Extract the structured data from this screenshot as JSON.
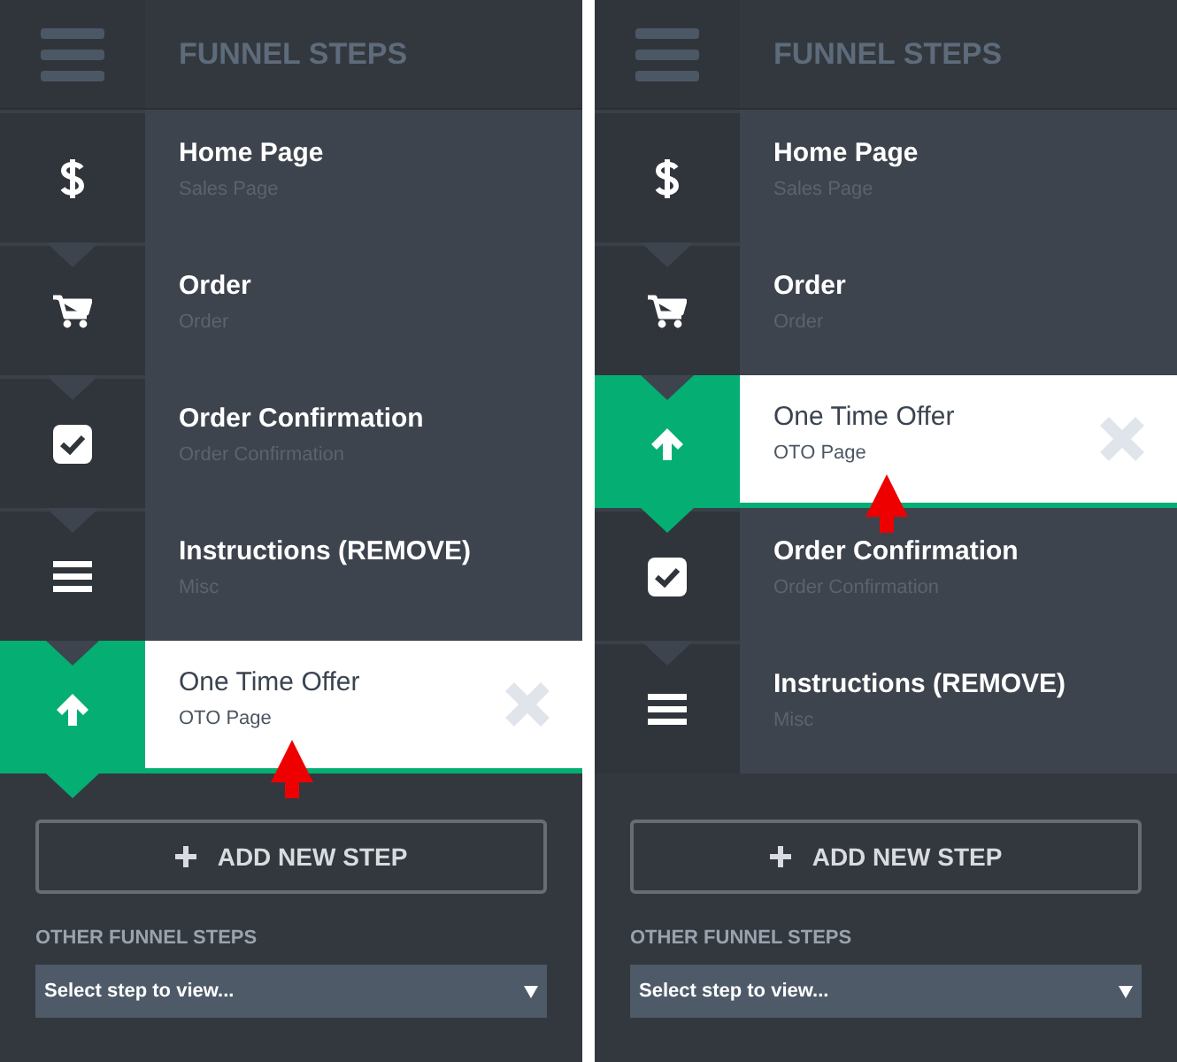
{
  "panels": [
    {
      "header": {
        "title": "FUNNEL STEPS"
      },
      "steps": [
        {
          "kind": "dollar",
          "title": "Home Page",
          "subtitle": "Sales Page",
          "selected": false
        },
        {
          "kind": "cart",
          "title": "Order",
          "subtitle": "Order",
          "selected": false
        },
        {
          "kind": "check",
          "title": "Order Confirmation",
          "subtitle": "Order Confirmation",
          "selected": false
        },
        {
          "kind": "list",
          "title": "Instructions (REMOVE)",
          "subtitle": "Misc",
          "selected": false
        },
        {
          "kind": "up",
          "title": "One Time Offer",
          "subtitle": "OTO Page",
          "selected": true
        }
      ],
      "add_button": "ADD NEW STEP",
      "other_label": "OTHER FUNNEL STEPS",
      "select": {
        "value": "Select step to view..."
      }
    },
    {
      "header": {
        "title": "FUNNEL STEPS"
      },
      "steps": [
        {
          "kind": "dollar",
          "title": "Home Page",
          "subtitle": "Sales Page",
          "selected": false
        },
        {
          "kind": "cart",
          "title": "Order",
          "subtitle": "Order",
          "selected": false
        },
        {
          "kind": "up",
          "title": "One Time Offer",
          "subtitle": "OTO Page",
          "selected": true
        },
        {
          "kind": "check",
          "title": "Order Confirmation",
          "subtitle": "Order Confirmation",
          "selected": false
        },
        {
          "kind": "list",
          "title": "Instructions (REMOVE)",
          "subtitle": "Misc",
          "selected": false
        }
      ],
      "add_button": "ADD NEW STEP",
      "other_label": "OTHER FUNNEL STEPS",
      "select": {
        "value": "Select step to view..."
      }
    }
  ]
}
